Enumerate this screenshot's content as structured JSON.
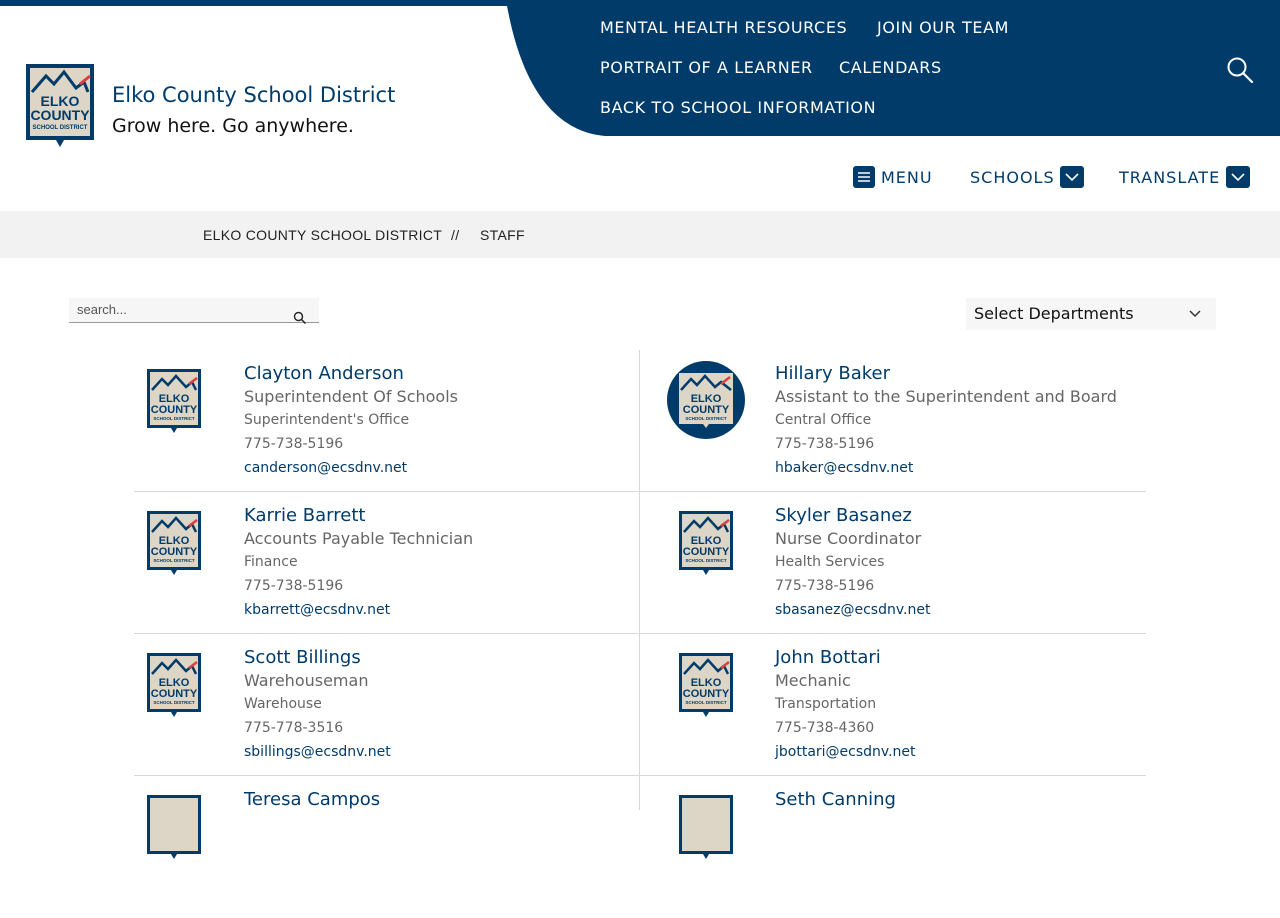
{
  "colors": {
    "navy": "#003b6a",
    "accent_red": "#d94040"
  },
  "header": {
    "site_name": "Elko County School District",
    "tagline": "Grow here. Go anywhere.",
    "logo_text": [
      "ELKO",
      "COUNTY",
      "SCHOOL DISTRICT"
    ],
    "top_links": [
      "MENTAL HEALTH RESOURCES",
      "JOIN OUR TEAM",
      "PORTRAIT OF A LEARNER",
      "CALENDARS",
      "BACK TO SCHOOL INFORMATION"
    ],
    "search_icon": "magnifier-icon",
    "nav": {
      "menu": "MENU",
      "schools": "SCHOOLS",
      "translate": "TRANSLATE"
    }
  },
  "breadcrumb": {
    "home": "ELKO COUNTY SCHOOL DISTRICT",
    "separator": "//",
    "current": "STAFF"
  },
  "filters": {
    "search_placeholder": "search...",
    "department_select": "Select Departments"
  },
  "staff": [
    {
      "name": "Clayton Anderson",
      "title": "Superintendent Of Schools",
      "department": "Superintendent's Office",
      "phone": "775-738-5196",
      "email": "canderson@ecsdnv.net"
    },
    {
      "name": "Hillary Baker",
      "title": "Assistant to the Superintendent and Board",
      "department": "Central Office",
      "phone": "775-738-5196",
      "email": "hbaker@ecsdnv.net"
    },
    {
      "name": "Karrie Barrett",
      "title": "Accounts Payable Technician",
      "department": "Finance",
      "phone": "775-738-5196",
      "email": "kbarrett@ecsdnv.net"
    },
    {
      "name": "Skyler Basanez",
      "title": "Nurse Coordinator",
      "department": "Health Services",
      "phone": "775-738-5196",
      "email": "sbasanez@ecsdnv.net"
    },
    {
      "name": "Scott Billings",
      "title": "Warehouseman",
      "department": "Warehouse",
      "phone": "775-778-3516",
      "email": "sbillings@ecsdnv.net"
    },
    {
      "name": "John Bottari",
      "title": "Mechanic",
      "department": "Transportation",
      "phone": "775-738-4360",
      "email": "jbottari@ecsdnv.net"
    },
    {
      "name": "Teresa Campos"
    },
    {
      "name": "Seth Canning"
    }
  ]
}
